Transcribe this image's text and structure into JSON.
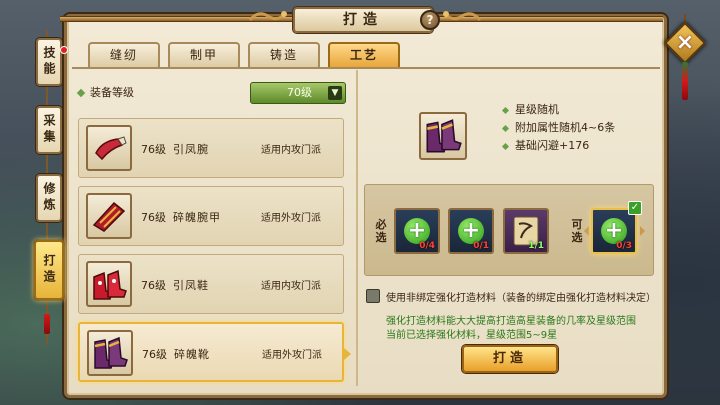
{
  "title": "打造",
  "help_icon": "?",
  "close_icon": "×",
  "side_nav": [
    {
      "label": "技能",
      "active": false,
      "badge": true
    },
    {
      "label": "采集",
      "active": false
    },
    {
      "label": "修炼",
      "active": false
    },
    {
      "label": "打造",
      "active": true
    }
  ],
  "tabs": [
    {
      "label": "缝纫",
      "active": false
    },
    {
      "label": "制甲",
      "active": false
    },
    {
      "label": "铸造",
      "active": false
    },
    {
      "label": "工艺",
      "active": true
    }
  ],
  "list": {
    "header_label": "装备等级",
    "level_select": "70级",
    "items": [
      {
        "level": "76级",
        "name": "引凤腕",
        "school": "适用内攻门派",
        "icon": "bracer-icon",
        "selected": false
      },
      {
        "level": "76级",
        "name": "碎魄腕甲",
        "school": "适用外攻门派",
        "icon": "armguard-icon",
        "selected": false
      },
      {
        "level": "76级",
        "name": "引凤鞋",
        "school": "适用内攻门派",
        "icon": "shoes-icon",
        "selected": false
      },
      {
        "level": "76级",
        "name": "碎魄靴",
        "school": "适用外攻门派",
        "icon": "boots-icon",
        "selected": true
      }
    ]
  },
  "detail": {
    "icon": "boots-icon",
    "attributes": [
      "星级随机",
      "附加属性随机4~6条",
      "基础闪避+176"
    ]
  },
  "materials": {
    "required_label": "必选",
    "optional_label": "可选",
    "required": [
      {
        "icon": "plus-icon",
        "count": "0/4"
      },
      {
        "icon": "plus-icon",
        "count": "0/1"
      },
      {
        "icon": "scroll-icon",
        "count": "1/1"
      }
    ],
    "optional": {
      "icon": "plus-icon",
      "count": "0/3",
      "checked": true
    }
  },
  "bind_option": "使用非绑定强化打造材料（装备的绑定由强化打造材料决定）",
  "hint_line1": "强化打造材料能大大提高打造高星装备的几率及星级范围",
  "hint_line2": "当前已选择强化材料，星级范围5~9星",
  "craft_button": "打造"
}
